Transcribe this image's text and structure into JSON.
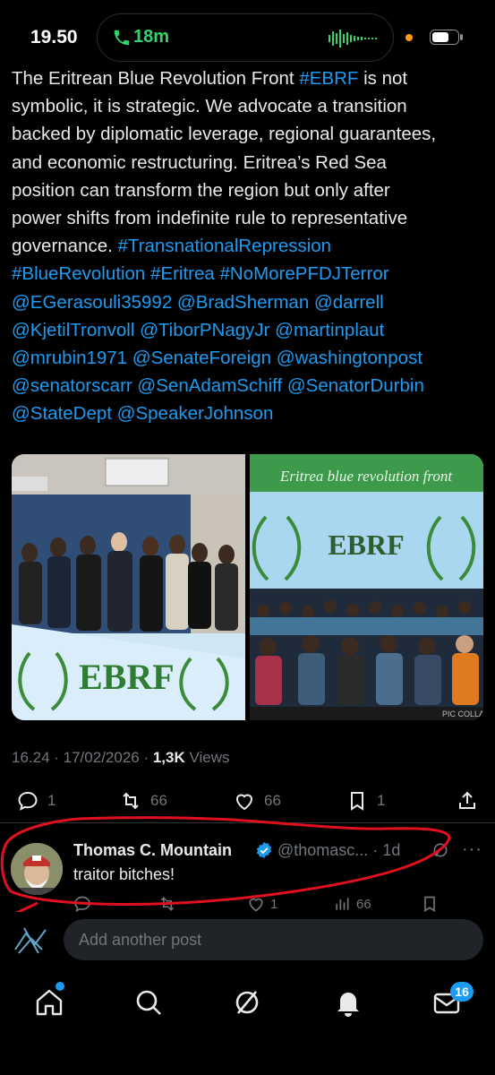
{
  "status_bar": {
    "time": "19.50",
    "call_duration": "18m",
    "call_color": "#33d46b"
  },
  "tweet": {
    "lines": [
      [
        {
          "t": "The Eritrean Blue Revolution Front "
        },
        {
          "t": "#EBRF",
          "link": true
        },
        {
          "t": " is not"
        }
      ],
      [
        {
          "t": "symbolic, it is strategic. We advocate a transition"
        }
      ],
      [
        {
          "t": "backed by diplomatic leverage, regional guarantees,"
        }
      ],
      [
        {
          "t": "and economic restructuring. Eritrea’s Red Sea"
        }
      ],
      [
        {
          "t": "position can transform the region but only after"
        }
      ],
      [
        {
          "t": "power shifts from indefinite rule to representative"
        }
      ],
      [
        {
          "t": "governance. "
        },
        {
          "t": "#TransnationalRepression",
          "link": true
        }
      ],
      [
        {
          "t": "#BlueRevolution #Eritrea #NoMorePFDJTerror",
          "link": true
        }
      ],
      [
        {
          "t": "@EGerasouli35992 @BradSherman @darrell",
          "link": true
        }
      ],
      [
        {
          "t": "@KjetilTronvoll @TiborPNagyJr @martinplaut",
          "link": true
        }
      ],
      [
        {
          "t": "@mrubin1971 @SenateForeign @washingtonpost",
          "link": true
        }
      ],
      [
        {
          "t": "@senatorscarr @SenAdamSchiff @SenatorDurbin",
          "link": true
        }
      ],
      [
        {
          "t": "@StateDept @SpeakerJohnson",
          "link": true
        }
      ]
    ],
    "link_color": "#1d9bf0",
    "media": {
      "left_banner_text": "EBRF",
      "right_header_text": "Eritrea blue revolution front",
      "right_banner_text": "EBRF",
      "collage_watermark": "PIC COLLAGE"
    },
    "timestamp": "16.24 · 17/02/2026 · ",
    "views_count": "1,3K",
    "views_label": " Views",
    "actions": {
      "replies": "1",
      "reposts": "66",
      "likes": "66",
      "bookmarks": "1"
    }
  },
  "reply": {
    "name": "Thomas C. Mountain",
    "handle": "@thomasc...",
    "age": "· 1d",
    "text": "traitor bitches!",
    "likes": "1",
    "views": "66",
    "more": "···"
  },
  "composer": {
    "placeholder": "Add another post"
  },
  "nav": {
    "messages_badge": "16",
    "accent": "#1d9bf0"
  }
}
